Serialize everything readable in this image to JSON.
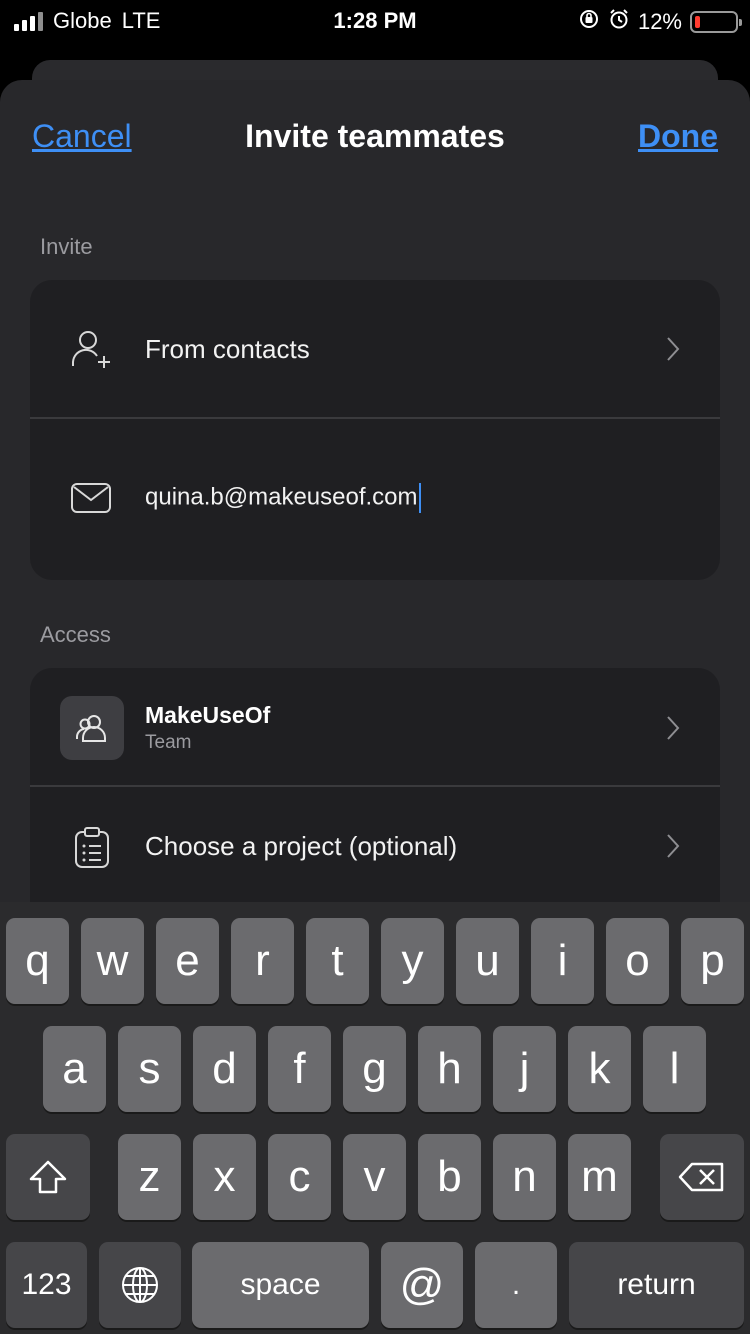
{
  "status_bar": {
    "carrier": "Globe",
    "network": "LTE",
    "time": "1:28 PM",
    "battery_percent": "12%",
    "battery_level": 0.12,
    "battery_color": "#ff3b30"
  },
  "nav": {
    "cancel_label": "Cancel",
    "title": "Invite teammates",
    "done_label": "Done",
    "accent_color": "#3e8ff5"
  },
  "invite": {
    "section_label": "Invite",
    "from_contacts_label": "From contacts",
    "email_value": "quina.b@makeuseof.com"
  },
  "access": {
    "section_label": "Access",
    "team_name": "MakeUseOf",
    "team_subtitle": "Team",
    "project_label": "Choose a project (optional)"
  },
  "keyboard": {
    "row1": [
      "q",
      "w",
      "e",
      "r",
      "t",
      "y",
      "u",
      "i",
      "o",
      "p"
    ],
    "row2": [
      "a",
      "s",
      "d",
      "f",
      "g",
      "h",
      "j",
      "k",
      "l"
    ],
    "row3": [
      "z",
      "x",
      "c",
      "v",
      "b",
      "n",
      "m"
    ],
    "numbers_label": "123",
    "space_label": "space",
    "at_label": "@",
    "dot_label": ".",
    "return_label": "return"
  }
}
